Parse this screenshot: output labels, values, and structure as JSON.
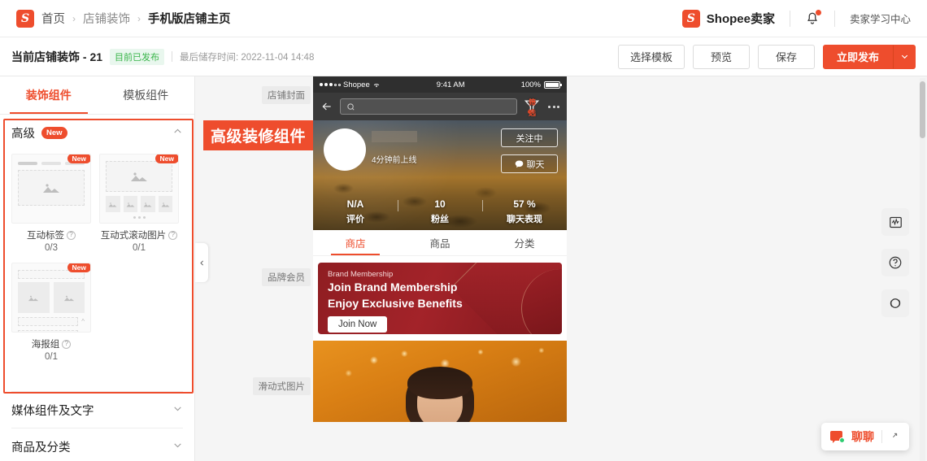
{
  "topbar": {
    "logo_icon": "shopee-logo-icon",
    "breadcrumbs": [
      {
        "label": "首页"
      },
      {
        "label": "店铺装饰"
      },
      {
        "label": "手机版店铺主页"
      }
    ],
    "separator": "›",
    "brand_name": "Shopee卖家",
    "bell_icon": "bell-icon",
    "learn_center": "卖家学习中心"
  },
  "actionbar": {
    "title": "当前店铺装饰 - 21",
    "status_badge": "目前已发布",
    "saved_time": "最后储存时间: 2022-11-04 14:48",
    "buttons": {
      "template": "选择模板",
      "preview": "预览",
      "save": "保存",
      "publish": "立即发布",
      "publish_more_icon": "chevron-down-icon"
    }
  },
  "leftpanel": {
    "tabs": [
      {
        "label": "装饰组件",
        "active": true
      },
      {
        "label": "模板组件",
        "active": false
      }
    ],
    "sections": [
      {
        "title": "高级",
        "badge": "New",
        "expanded": true,
        "chevron": "chevron-up-icon",
        "components": [
          {
            "label": "互动标签",
            "count": "0/3",
            "badge": "New",
            "help_icon": "help-icon",
            "thumb": "interactive-tab-thumb"
          },
          {
            "label": "互动式滚动图片",
            "count": "0/1",
            "badge": "New",
            "help_icon": "help-icon",
            "thumb": "scroll-image-thumb"
          },
          {
            "label": "海报组",
            "count": "0/1",
            "badge": "New",
            "help_icon": "help-icon",
            "thumb": "poster-group-thumb"
          }
        ]
      },
      {
        "title": "媒体组件及文字",
        "expanded": false,
        "chevron": "chevron-down-icon",
        "components": []
      },
      {
        "title": "商品及分类",
        "expanded": false,
        "chevron": "chevron-down-icon",
        "components": []
      }
    ]
  },
  "canvas": {
    "annotation": "高级装修组件",
    "collapse_icon": "chevron-left-icon",
    "row_labels": [
      {
        "label": "店铺封面"
      },
      {
        "label": "品牌会员"
      },
      {
        "label": "滑动式图片"
      }
    ],
    "phone": {
      "statusbar": {
        "carrier": "Shopee",
        "time": "9:41 AM",
        "battery": "100%",
        "wifi_icon": "wifi-icon",
        "signal_icon": "signal-dots-icon"
      },
      "navbar": {
        "back_icon": "back-arrow-icon",
        "search_icon": "search-icon",
        "search_placeholder": "",
        "filter_icon": "filter-icon",
        "filter_label": "筛选",
        "more_icon": "kebab-menu-icon"
      },
      "shop": {
        "avatar": "shop-avatar",
        "online_text": "4分钟前上线",
        "follow_button": "关注中",
        "chat_button": "聊天",
        "chat_icon": "chat-bubble-icon",
        "stats": [
          {
            "value": "N/A",
            "label": "评价"
          },
          {
            "value": "10",
            "label": "粉丝"
          },
          {
            "value": "57 %",
            "label": "聊天表现"
          }
        ]
      },
      "tabs": [
        {
          "label": "商店",
          "active": true
        },
        {
          "label": "商品",
          "active": false
        },
        {
          "label": "分类",
          "active": false
        }
      ],
      "brand_banner": {
        "kicker": "Brand Membership",
        "headline_1": "Join Brand Membership",
        "headline_2": "Enjoy Exclusive Benefits",
        "cta": "Join Now"
      }
    }
  },
  "rail": {
    "buttons": [
      {
        "icon": "analytics-icon"
      },
      {
        "icon": "help-circle-icon"
      },
      {
        "icon": "refresh-circle-icon"
      }
    ]
  },
  "chat_widget": {
    "label": "聊聊",
    "chat_icon": "chat-widget-icon",
    "expand_icon": "expand-icon"
  },
  "colors": {
    "accent": "#ee4d2d",
    "published_green": "#39b54a",
    "banner_red": "#a32329"
  }
}
